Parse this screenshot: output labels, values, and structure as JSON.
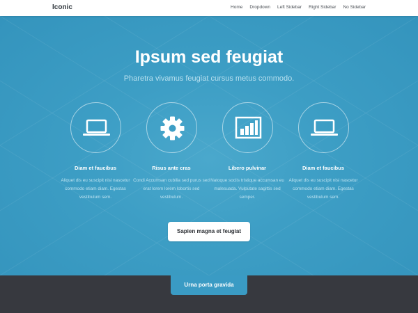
{
  "nav": {
    "brand": "Iconic",
    "links": [
      "Home",
      "Dropdown",
      "Left Sidebar",
      "Right Sidebar",
      "No Sidebar"
    ]
  },
  "hero": {
    "title": "Ipsum sed feugiat",
    "subtitle": "Pharetra vivamus feugiat cursus metus commodo.",
    "button": "Sapien magna et feugiat"
  },
  "features": [
    {
      "icon": "laptop-icon",
      "title": "Diam et faucibus",
      "desc": "Aliquet dis eu suscipit nisi nascetur commodo etiam diam. Egestas vestibulum sem."
    },
    {
      "icon": "gear-icon",
      "title": "Risus ante cras",
      "desc": "Condi Accumsan cubilia sed purus sed erat lorem lorem lobortis sed vestibulum."
    },
    {
      "icon": "bar-chart-icon",
      "title": "Libero pulvinar",
      "desc": "Natoque sociis tristique accumsan eu malesuada. Vulputate sagittis sed semper."
    },
    {
      "icon": "laptop-icon",
      "title": "Diam et faucibus",
      "desc": "Aliquet dis eu suscipit nisi nascetur commodo etiam diam. Egestas vestibulum sem."
    }
  ],
  "footer_tab": "Urna porta gravida",
  "colors": {
    "hero_bg": "#3494bd",
    "footer_bg": "#37393f",
    "accent": "#3a9bc4"
  }
}
